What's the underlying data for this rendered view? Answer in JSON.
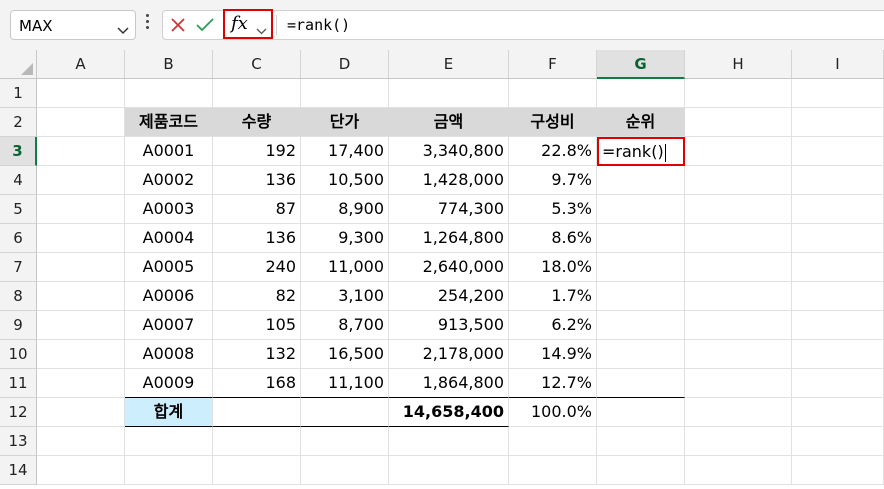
{
  "name_box": {
    "value": "MAX"
  },
  "formula_bar": {
    "fx_label": "fx",
    "formula": "=rank()"
  },
  "columns": [
    "A",
    "B",
    "C",
    "D",
    "E",
    "F",
    "G",
    "H",
    "I"
  ],
  "rows": [
    "1",
    "2",
    "3",
    "4",
    "5",
    "6",
    "7",
    "8",
    "9",
    "10",
    "11",
    "12",
    "13",
    "14"
  ],
  "table": {
    "headers": [
      "제품코드",
      "수량",
      "단가",
      "금액",
      "구성비",
      "순위"
    ],
    "data": [
      [
        "A0001",
        "192",
        "17,400",
        "3,340,800",
        "22.8%"
      ],
      [
        "A0002",
        "136",
        "10,500",
        "1,428,000",
        "9.7%"
      ],
      [
        "A0003",
        "87",
        "8,900",
        "774,300",
        "5.3%"
      ],
      [
        "A0004",
        "136",
        "9,300",
        "1,264,800",
        "8.6%"
      ],
      [
        "A0005",
        "240",
        "11,000",
        "2,640,000",
        "18.0%"
      ],
      [
        "A0006",
        "82",
        "3,100",
        "254,200",
        "1.7%"
      ],
      [
        "A0007",
        "105",
        "8,700",
        "913,500",
        "6.2%"
      ],
      [
        "A0008",
        "132",
        "16,500",
        "2,178,000",
        "14.9%"
      ],
      [
        "A0009",
        "168",
        "11,100",
        "1,864,800",
        "12.7%"
      ]
    ],
    "total": {
      "label": "합계",
      "amount": "14,658,400",
      "ratio": "100.0%"
    },
    "editing_cell": {
      "ref": "G3",
      "value": "=rank()"
    }
  },
  "colors": {
    "selection": "#107c41",
    "highlight": "#e00000",
    "header_fill": "#d9d9d9",
    "total_fill": "#cdeefc"
  }
}
